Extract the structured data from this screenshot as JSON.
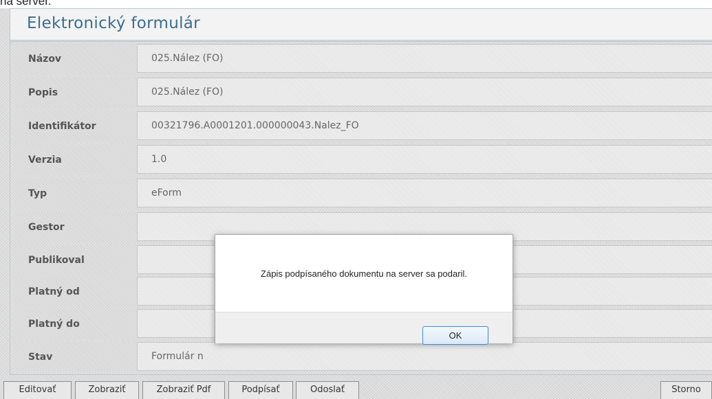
{
  "top_text": "na server.",
  "header": {
    "title": "Elektronický formulár"
  },
  "fields": [
    {
      "label": "Názov",
      "value": "025.Nález (FO)"
    },
    {
      "label": "Popis",
      "value": "025.Nález (FO)"
    },
    {
      "label": "Identifikátor",
      "value": "00321796.A0001201.000000043.Nalez_FO"
    },
    {
      "label": "Verzia",
      "value": "1.0"
    },
    {
      "label": "Typ",
      "value": "eForm"
    },
    {
      "label": "Gestor",
      "value": ""
    },
    {
      "label": "Publikoval",
      "value": ""
    },
    {
      "label": "Platný od",
      "value": ""
    },
    {
      "label": "Platný do",
      "value": ""
    },
    {
      "label": "Stav",
      "value": "Formulár n"
    }
  ],
  "toolbar": {
    "edit": "Editovať",
    "show": "Zobraziť",
    "show_pdf": "Zobraziť Pdf",
    "sign": "Podpísať",
    "send": "Odoslať",
    "cancel": "Storno"
  },
  "dialog": {
    "message": "Zápis podpísaného dokumentu na server sa podaril.",
    "ok": "OK"
  }
}
